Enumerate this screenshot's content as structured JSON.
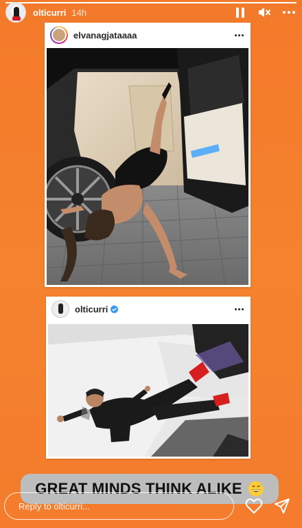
{
  "story": {
    "username": "olticurri",
    "time_ago": "14h",
    "progress_fraction": 1.0,
    "background_color": "#f47c2c"
  },
  "top_actions": {
    "pause_icon": "pause-icon",
    "mute_icon": "mute-icon",
    "more_icon": "more-icon"
  },
  "post1": {
    "username": "elvanagjataaaa",
    "verified": false
  },
  "post2": {
    "username": "olticurri",
    "verified": true
  },
  "caption": {
    "text": "GREAT MINDS THINK ALIKE",
    "emoji": "grinning-sweat-emoji"
  },
  "reply": {
    "placeholder": "Reply to olticurri..."
  },
  "colors": {
    "accent": "#f47c2c",
    "verified_blue": "#3897f0",
    "caption_bg": "#bdbdbd"
  }
}
